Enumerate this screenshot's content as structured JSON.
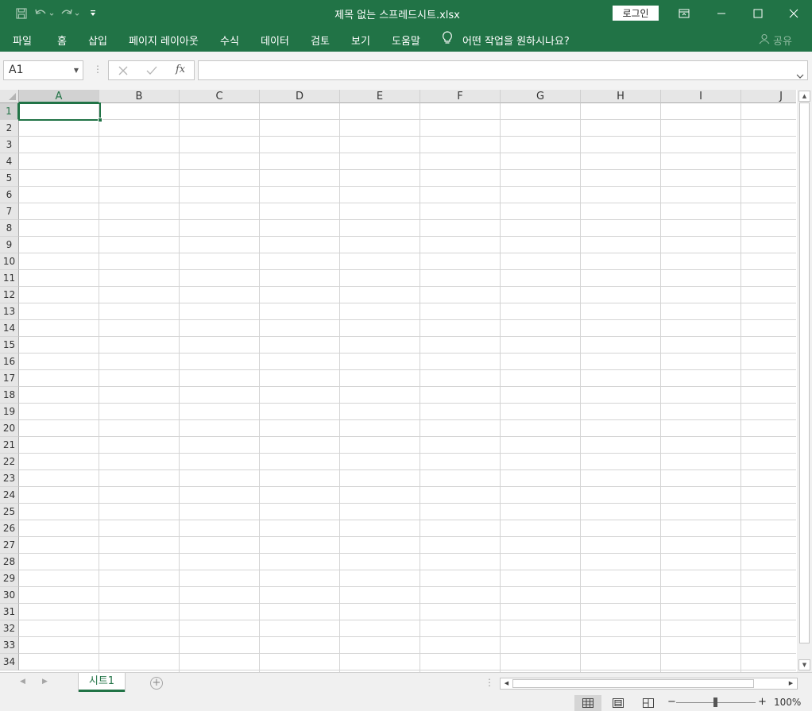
{
  "titlebar": {
    "title": "제목 없는 스프레드시트.xlsx",
    "login_label": "로그인"
  },
  "menu": {
    "items": [
      "파일",
      "홈",
      "삽입",
      "페이지 레이아웃",
      "수식",
      "데이터",
      "검토",
      "보기",
      "도움말"
    ],
    "tell_me": "어떤 작업을 원하시나요?",
    "share": "공유"
  },
  "formula": {
    "name_box": "A1",
    "fx": "fx",
    "value": ""
  },
  "grid": {
    "columns": [
      "A",
      "B",
      "C",
      "D",
      "E",
      "F",
      "G",
      "H",
      "I",
      "J"
    ],
    "rows": [
      "1",
      "2",
      "3",
      "4",
      "5",
      "6",
      "7",
      "8",
      "9",
      "10",
      "11",
      "12",
      "13",
      "14",
      "15",
      "16",
      "17",
      "18",
      "19",
      "20",
      "21",
      "22",
      "23",
      "24",
      "25",
      "26",
      "27",
      "28",
      "29",
      "30",
      "31",
      "32",
      "33",
      "34"
    ],
    "selected_cell": "A1"
  },
  "sheets": {
    "tabs": [
      "시트1"
    ],
    "active": "시트1"
  },
  "status": {
    "zoom": "100%"
  },
  "colors": {
    "brand": "#217346"
  }
}
